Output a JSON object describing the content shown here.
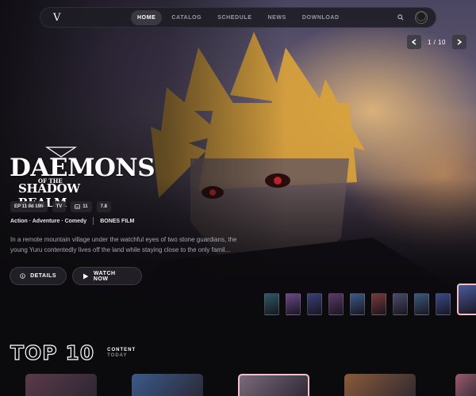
{
  "nav": {
    "logo": "V",
    "links": [
      {
        "label": "HOME",
        "active": true
      },
      {
        "label": "CATALOG",
        "active": false
      },
      {
        "label": "SCHEDULE",
        "active": false
      },
      {
        "label": "NEWS",
        "active": false
      },
      {
        "label": "DOWNLOAD",
        "active": false
      }
    ],
    "search_icon": "search-icon",
    "avatar": "avatar"
  },
  "pager": {
    "text": "1 / 10",
    "prev_icon": "chevron-left-icon",
    "next_icon": "chevron-right-icon"
  },
  "featured": {
    "title_line1": "DAEMONS",
    "title_connector": "OF THE",
    "title_line2": "SHADOW REALM",
    "chips": [
      {
        "label": "EP 11 0d 19h"
      },
      {
        "label": "TV"
      },
      {
        "label": "11",
        "icon": "subtitles-icon"
      },
      {
        "label": "7.8"
      }
    ],
    "genres": "Action · Adventure · Comedy",
    "studio": "BONES FILM",
    "description": "In a remote mountain village under the watchful eyes of two stone guardians, the young Yuru contentedly lives off the land while staying close to the only famil...",
    "details_label": "DETAILS",
    "watch_label": "WATCH NOW"
  },
  "thumbnails": {
    "colors": [
      "#2b5a66",
      "#6a4a8a",
      "#3a3f78",
      "#5a3a6a",
      "#3c5a88",
      "#7a3a3a",
      "#4a4a6a",
      "#3a5a7a",
      "#3a4a8a"
    ],
    "active_index": 9
  },
  "top10": {
    "title": "TOP 10",
    "subtitle1": "CONTENT",
    "subtitle2": "TODAY"
  },
  "cards": {
    "colors": [
      "#5a3a4a",
      "#3a5a8a",
      "#7a6a7a",
      "#8a5a3a"
    ],
    "highlight_index": 2,
    "partial_color": "#9a5a6a"
  }
}
